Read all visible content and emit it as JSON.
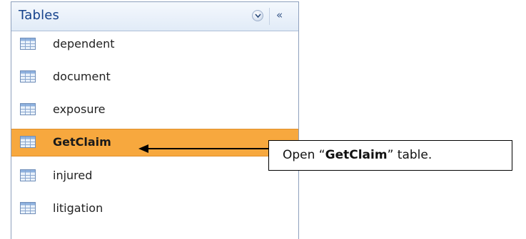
{
  "pane": {
    "title": "Tables",
    "dropdown_icon": "chevron-down-icon",
    "collapse_label": "«"
  },
  "items": [
    {
      "label": "dependent",
      "icon": "table-icon",
      "selected": false
    },
    {
      "label": "document",
      "icon": "table-icon",
      "selected": false
    },
    {
      "label": "exposure",
      "icon": "table-icon",
      "selected": false
    },
    {
      "label": "GetClaim",
      "icon": "table-icon",
      "selected": true
    },
    {
      "label": "injured",
      "icon": "table-icon",
      "selected": false
    },
    {
      "label": "litigation",
      "icon": "table-icon",
      "selected": false
    }
  ],
  "callout": {
    "prefix": "Open “",
    "emphasis": "GetClaim",
    "suffix": "” table."
  },
  "colors": {
    "selected_bg": "#f7a83e",
    "header_text": "#15428b"
  }
}
